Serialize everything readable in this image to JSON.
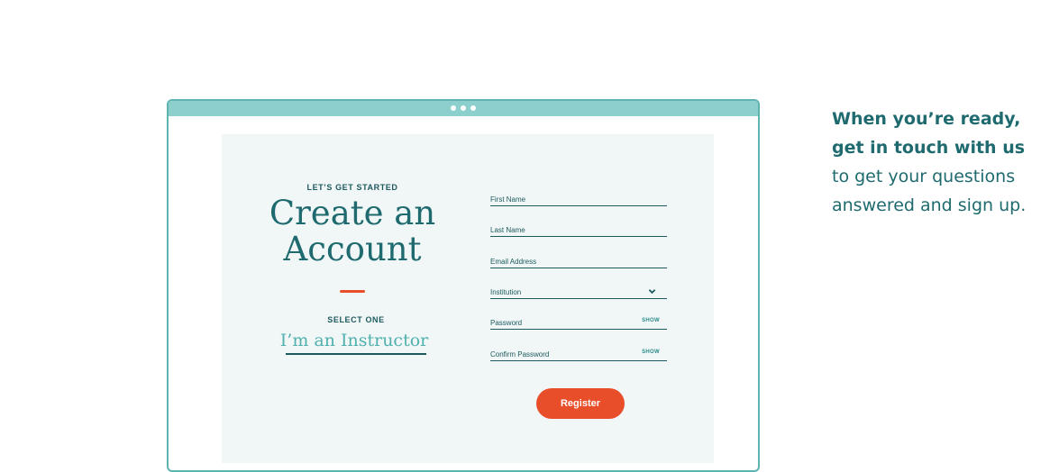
{
  "browser": {
    "dots": [
      "",
      "",
      ""
    ]
  },
  "signup": {
    "eyebrow": "LET’S GET STARTED",
    "title_line1": "Create an",
    "title_line2": "Account",
    "select_label": "SELECT ONE",
    "role_value": "I’m an Instructor",
    "fields": [
      {
        "label": "First Name"
      },
      {
        "label": "Last Name"
      },
      {
        "label": "Email Address"
      },
      {
        "label": "Institution"
      },
      {
        "label": "Password",
        "action": "SHOW"
      },
      {
        "label": "Confirm Password",
        "action": "SHOW"
      }
    ],
    "register_label": "Register"
  },
  "side": {
    "line1": "When you’re ready,",
    "line2": "get in touch with us",
    "line3": "to get your questions",
    "line4": "answered and sign up."
  },
  "colors": {
    "teal_dark": "#1e6a6f",
    "teal_light": "#8ccfcc",
    "accent": "#e94e2b",
    "panel_bg": "#f1f7f7"
  },
  "icons": {
    "role_dropdown": "chevron-down-icon",
    "institution_dropdown": "chevron-down-icon"
  }
}
